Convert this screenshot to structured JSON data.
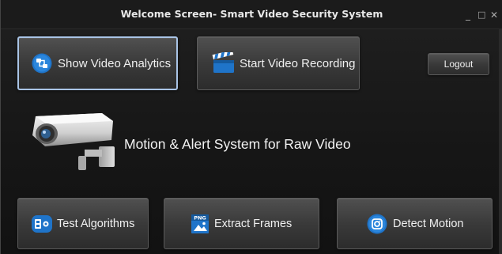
{
  "window": {
    "title": "Welcome Screen- Smart Video Security System",
    "minimize_glyph": "_",
    "maximize_glyph": "□",
    "close_glyph": "✕"
  },
  "top_buttons": {
    "show_video_analytics": {
      "label": "Show Video Analytics",
      "icon": "analytics-icon",
      "selected": true
    },
    "start_video_recording": {
      "label": "Start Video Recording",
      "icon": "video-clapper-icon"
    },
    "logout": {
      "label": "Logout"
    }
  },
  "hero": {
    "icon": "security-camera-icon",
    "text": "Motion & Alert System for Raw Video"
  },
  "bottom_buttons": {
    "test_algorithms": {
      "label": "Test Algorithms",
      "icon": "algorithms-icon"
    },
    "extract_frames": {
      "label": "Extract Frames",
      "icon": "png-image-icon",
      "icon_text": "PNG"
    },
    "detect_motion": {
      "label": "Detect Motion",
      "icon": "motion-sensor-icon"
    }
  },
  "colors": {
    "background": "#161616",
    "button_top": "#505050",
    "button_bottom": "#2c2c2c",
    "selection_border": "#a9c4e6",
    "icon_blue": "#1f74c9"
  }
}
